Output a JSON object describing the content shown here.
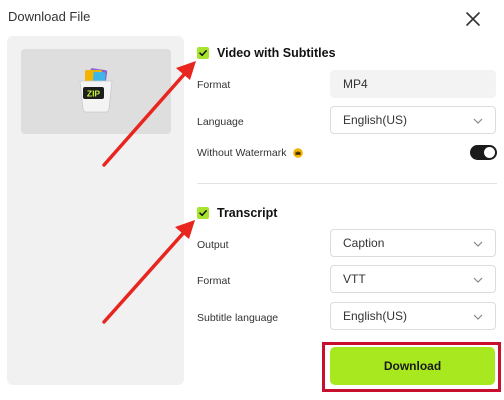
{
  "dialog": {
    "title": "Download File"
  },
  "preview": {
    "icon_text": "ZIP"
  },
  "video_section": {
    "label": "Video with Subtitles",
    "checked": true,
    "format_label": "Format",
    "format_value": "MP4",
    "language_label": "Language",
    "language_value": "English(US)",
    "watermark_label": "Without Watermark",
    "watermark_enabled": true
  },
  "transcript_section": {
    "label": "Transcript",
    "checked": true,
    "output_label": "Output",
    "output_value": "Caption",
    "format_label": "Format",
    "format_value": "VTT",
    "subtitle_language_label": "Subtitle language",
    "subtitle_language_value": "English(US)"
  },
  "actions": {
    "download_label": "Download"
  },
  "colors": {
    "accent": "#a8e81e",
    "highlight": "#c8102e",
    "annotation_arrow": "#e8251f"
  }
}
